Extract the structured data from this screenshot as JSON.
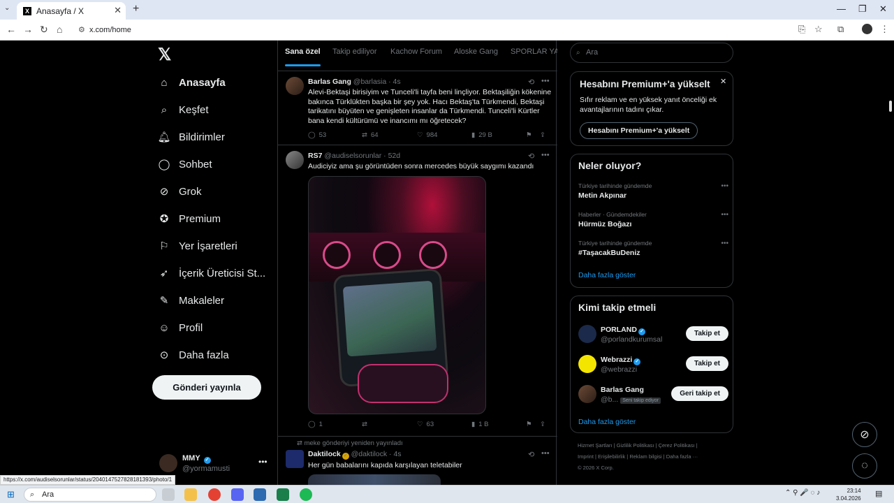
{
  "browser": {
    "tab_title": "Anasayfa / X",
    "url": "x.com/home",
    "status_url": "https://x.com/audiselsorunlar/status/2040147527828181393/photo/1"
  },
  "nav": {
    "items": [
      {
        "label": "Anasayfa",
        "icon": "home-icon"
      },
      {
        "label": "Keşfet",
        "icon": "search-icon"
      },
      {
        "label": "Bildirimler",
        "icon": "bell-icon"
      },
      {
        "label": "Sohbet",
        "icon": "chat-icon"
      },
      {
        "label": "Grok",
        "icon": "grok-icon"
      },
      {
        "label": "Premium",
        "icon": "premium-icon"
      },
      {
        "label": "Yer İşaretleri",
        "icon": "bookmark-icon"
      },
      {
        "label": "İçerik Üreticisi St...",
        "icon": "rocket-icon"
      },
      {
        "label": "Makaleler",
        "icon": "article-icon"
      },
      {
        "label": "Profil",
        "icon": "person-icon"
      },
      {
        "label": "Daha fazla",
        "icon": "more-circle-icon"
      }
    ],
    "post_button": "Gönderi yayınla",
    "me": {
      "name": "MMY",
      "handle": "@yormamusti"
    }
  },
  "feed": {
    "tabs": [
      "Sana özel",
      "Takip ediliyor",
      "Kachow Forum",
      "Aloske Gang",
      "SPORLAR YAP"
    ],
    "tweets": [
      {
        "name": "Barlas Gang",
        "handle": "@barlasia",
        "time": "· 4s",
        "text": "Alevi-Bektaşi birisiyim ve Tunceli'li tayfa beni linçliyor. Bektaşiliğin kökenine bakınca Türklükten başka bir şey yok. Hacı Bektaş'ta Türkmendi, Bektaşi tarikatını büyüten ve genişleten insanlar da Türkmendi. Tunceli'li Kürtler bana kendi kültürümü ve inancımı mı öğretecek?",
        "replies": "53",
        "reposts": "64",
        "likes": "984",
        "views": "29 B"
      },
      {
        "name": "RS7",
        "handle": "@audiselsorunlar",
        "time": "· 52d",
        "text": "Audiciyiz ama şu görüntüden sonra mercedes büyük saygımı kazandı",
        "replies": "1",
        "reposts": "",
        "likes": "63",
        "views": "1 B"
      },
      {
        "retweeted_by": "meke gönderiyi yeniden yayınladı",
        "name": "Daktilock",
        "handle": "@daktilock",
        "time": "· 4s",
        "text": "Her gün babalarını kapıda karşılayan teletabiler"
      }
    ]
  },
  "right": {
    "search_placeholder": "Ara",
    "premium": {
      "title": "Hesabını Premium+'a yükselt",
      "desc": "Sıfır reklam ve en yüksek yanıt önceliği ek avantajlarının tadını çıkar.",
      "button": "Hesabını Premium+'a yükselt"
    },
    "trends": {
      "title": "Neler oluyor?",
      "items": [
        {
          "context": "Türkiye tarihinde gündemde",
          "topic": "Metin Akpınar"
        },
        {
          "context": "Haberler · Gündemdekiler",
          "topic": "Hürmüz Boğazı"
        },
        {
          "context": "Türkiye tarihinde gündemde",
          "topic": "#TaşacakBuDeniz"
        }
      ],
      "more": "Daha fazla göster"
    },
    "who_to_follow": {
      "title": "Kimi takip etmeli",
      "items": [
        {
          "name": "PORLAND",
          "handle": "@porlandkurumsal",
          "button": "Takip et",
          "badge": ""
        },
        {
          "name": "Webrazzi",
          "handle": "@webrazzi",
          "button": "Takip et",
          "badge": ""
        },
        {
          "name": "Barlas Gang",
          "handle": "@b...",
          "button": "Geri takip et",
          "badge": "Seni takip ediyor"
        }
      ],
      "more": "Daha fazla göster"
    },
    "footer": {
      "line1": "Hizmet Şartları | Gizlilik Politikası | Çerez Politikası |",
      "line2": "Imprint | Erişilebilirlik | Reklam bilgisi | Daha fazla ···",
      "line3": "© 2026 X Corp."
    }
  },
  "taskbar": {
    "search": "Ara",
    "time": "23:14",
    "date": "3.04.2026"
  },
  "colors": {
    "accent": "#1d9bf0",
    "bg": "#000000",
    "border": "#2f3336",
    "muted": "#71767b"
  }
}
